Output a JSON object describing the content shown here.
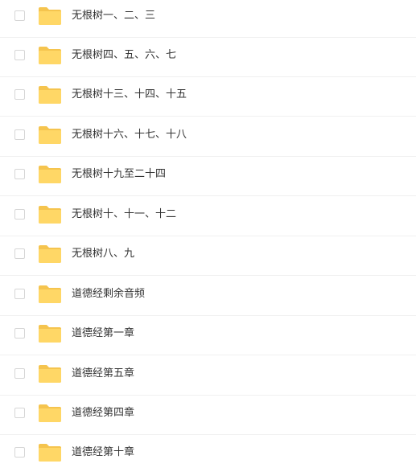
{
  "files": [
    {
      "name": "无根树一、二、三"
    },
    {
      "name": "无根树四、五、六、七"
    },
    {
      "name": "无根树十三、十四、十五"
    },
    {
      "name": "无根树十六、十七、十八"
    },
    {
      "name": "无根树十九至二十四"
    },
    {
      "name": "无根树十、十一、十二"
    },
    {
      "name": "无根树八、九"
    },
    {
      "name": "道德经剩余音频"
    },
    {
      "name": "道德经第一章"
    },
    {
      "name": "道德经第五章"
    },
    {
      "name": "道德经第四章"
    },
    {
      "name": "道德经第十章"
    }
  ],
  "colors": {
    "folder_back": "#F5C44E",
    "folder_front": "#FFD766",
    "text": "#333333",
    "divider": "#F0F0F0",
    "checkbox_border": "#D6D6D6"
  }
}
